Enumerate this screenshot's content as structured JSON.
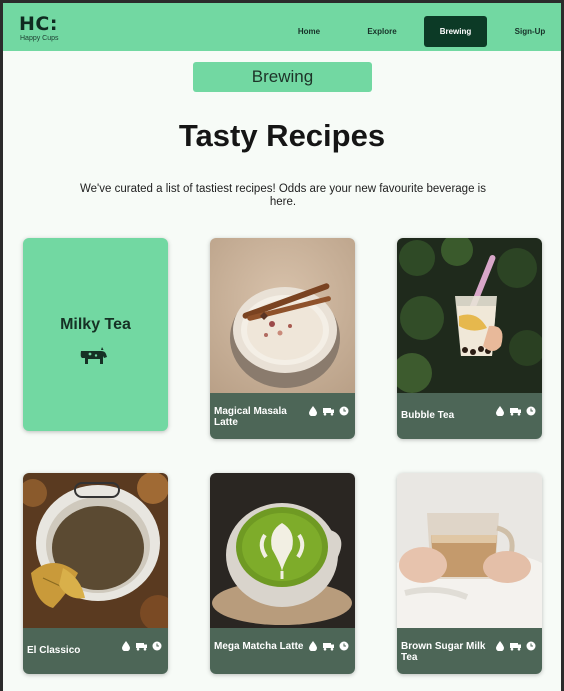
{
  "brand": {
    "mark": "HC:",
    "name": "Happy Cups"
  },
  "nav": {
    "items": [
      {
        "label": "Home",
        "active": false
      },
      {
        "label": "Explore",
        "active": false
      },
      {
        "label": "Brewing",
        "active": true
      },
      {
        "label": "Sign-Up",
        "active": false
      }
    ]
  },
  "section_badge": "Brewing",
  "page": {
    "title": "Tasty Recipes",
    "intro": "We've curated a list of tastiest recipes! Odds are your new favourite beverage is here."
  },
  "feature_card": {
    "title": "Milky Tea",
    "icon": "cow-icon"
  },
  "recipes": [
    {
      "name": "Magical Masala Latte",
      "photo": "masala-latte-photo",
      "icons": [
        "drop-icon",
        "truck-icon",
        "clock-icon"
      ]
    },
    {
      "name": "Bubble Tea",
      "photo": "bubble-tea-photo",
      "icons": [
        "drop-icon",
        "truck-icon",
        "clock-icon"
      ]
    },
    {
      "name": "El Classico",
      "photo": "classic-tea-photo",
      "icons": [
        "drop-icon",
        "truck-icon",
        "clock-icon"
      ]
    },
    {
      "name": "Mega Matcha Latte",
      "photo": "matcha-latte-photo",
      "icons": [
        "drop-icon",
        "truck-icon",
        "clock-icon"
      ]
    },
    {
      "name": "Brown Sugar Milk Tea",
      "photo": "brown-sugar-photo",
      "icons": [
        "drop-icon",
        "truck-icon",
        "clock-icon"
      ]
    }
  ],
  "colors": {
    "accent": "#72d8a2",
    "nav_active": "#0c3a26",
    "caption_bar": "#4d6657",
    "page_bg": "#f7fbf7"
  }
}
